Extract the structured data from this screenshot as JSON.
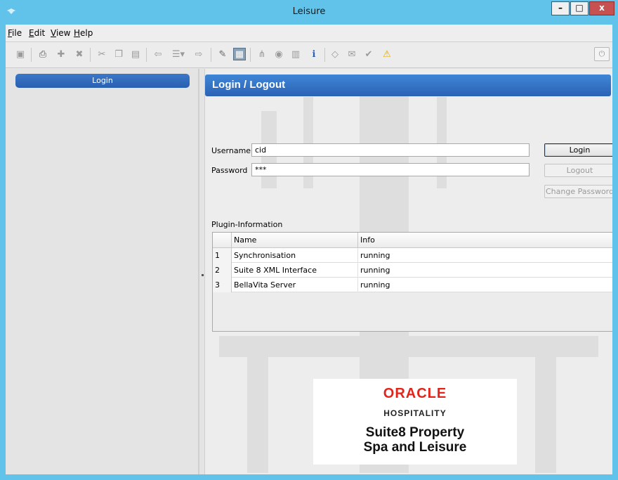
{
  "window": {
    "title": "Leisure",
    "minimize_glyph": "–",
    "maximize_glyph": "□",
    "close_glyph": "x"
  },
  "menu": {
    "items": [
      {
        "label": "File",
        "accel": "F",
        "rest": "ile"
      },
      {
        "label": "Edit",
        "accel": "E",
        "rest": "dit"
      },
      {
        "label": "View",
        "accel": "V",
        "rest": "iew"
      },
      {
        "label": "Help",
        "accel": "H",
        "rest": "elp"
      }
    ]
  },
  "toolbar": {
    "icons": [
      "save-icon",
      "print-icon",
      "add-icon",
      "delete-icon",
      "cut-icon",
      "copy-icon",
      "paste-icon",
      "back-icon",
      "list-icon",
      "forward-icon",
      "new-document-icon",
      "panel-icon",
      "tree-icon",
      "media-icon",
      "report-icon",
      "info-icon",
      "tag-icon",
      "note-icon",
      "check-icon",
      "warning-icon",
      "power-icon"
    ],
    "glyphs": {
      "save": "▣",
      "print": "⎙",
      "add": "✚",
      "delete": "✖",
      "cut": "✂",
      "copy": "❐",
      "paste": "▤",
      "back": "⇦",
      "list": "☰▾",
      "forward": "⇨",
      "new": "✎",
      "panel": "▦",
      "tree": "⋔",
      "media": "◉",
      "report": "▥",
      "info": "ℹ",
      "tag": "◇",
      "note": "✉",
      "check": "✔",
      "warning": "⚠",
      "power": "⏻"
    }
  },
  "left": {
    "login_button": "Login"
  },
  "main": {
    "header": "Login / Logout",
    "username_label": "Username",
    "username_value": "cid",
    "password_label": "Password",
    "password_value": "***",
    "login_button": "Login",
    "logout_button": "Logout",
    "change_password_button": "Change Password",
    "plugin_label": "Plugin-Information",
    "grid": {
      "columns": [
        "Name",
        "Info"
      ],
      "rows": [
        {
          "num": "1",
          "name": "Synchronisation",
          "info": "running"
        },
        {
          "num": "2",
          "name": "Suite 8 XML Interface",
          "info": "running"
        },
        {
          "num": "3",
          "name": "BellaVita Server",
          "info": "running"
        }
      ]
    }
  },
  "branding": {
    "logo": "ORACLE",
    "sub": "HOSPITALITY",
    "product_line1": "Suite8 Property",
    "product_line2": "Spa and Leisure"
  },
  "colors": {
    "title_bar": "#62c3ea",
    "accent_blue": "#2c62b5",
    "oracle_red": "#e2241a",
    "warning": "#f2b705",
    "info": "#2a5fb0"
  }
}
